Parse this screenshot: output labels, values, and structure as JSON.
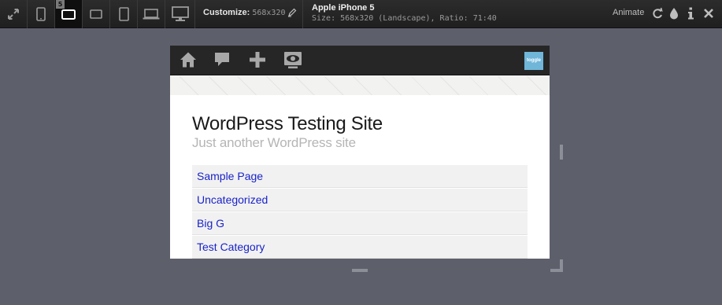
{
  "toolbar": {
    "devices": [
      {
        "name": "fullscreen-icon"
      },
      {
        "name": "phone-portrait-icon"
      },
      {
        "name": "phone-landscape-icon",
        "badge": "5",
        "active": true
      },
      {
        "name": "tablet-landscape-icon"
      },
      {
        "name": "tablet-portrait-icon"
      },
      {
        "name": "laptop-icon"
      },
      {
        "name": "desktop-icon"
      }
    ],
    "customize_label": "Customize:",
    "customize_value": "568x320",
    "device_name": "Apple iPhone 5",
    "device_info": "Size: 568x320 (Landscape), Ratio: 71:40",
    "animate_label": "Animate",
    "right_icons": [
      "rotate-icon",
      "drop-icon",
      "info-icon",
      "close-icon"
    ]
  },
  "site": {
    "nav_icons": [
      "home-icon",
      "comment-icon",
      "plus-icon",
      "eye-icon"
    ],
    "logo_text": "toggle",
    "title": "WordPress Testing Site",
    "tagline": "Just another WordPress site",
    "menu": [
      "Sample Page",
      "Uncategorized",
      "Big G",
      "Test Category"
    ]
  },
  "colors": {
    "background": "#5d5f6b",
    "toolbar": "#262626",
    "link": "#1a23c8",
    "logo": "#6fb6d9"
  }
}
